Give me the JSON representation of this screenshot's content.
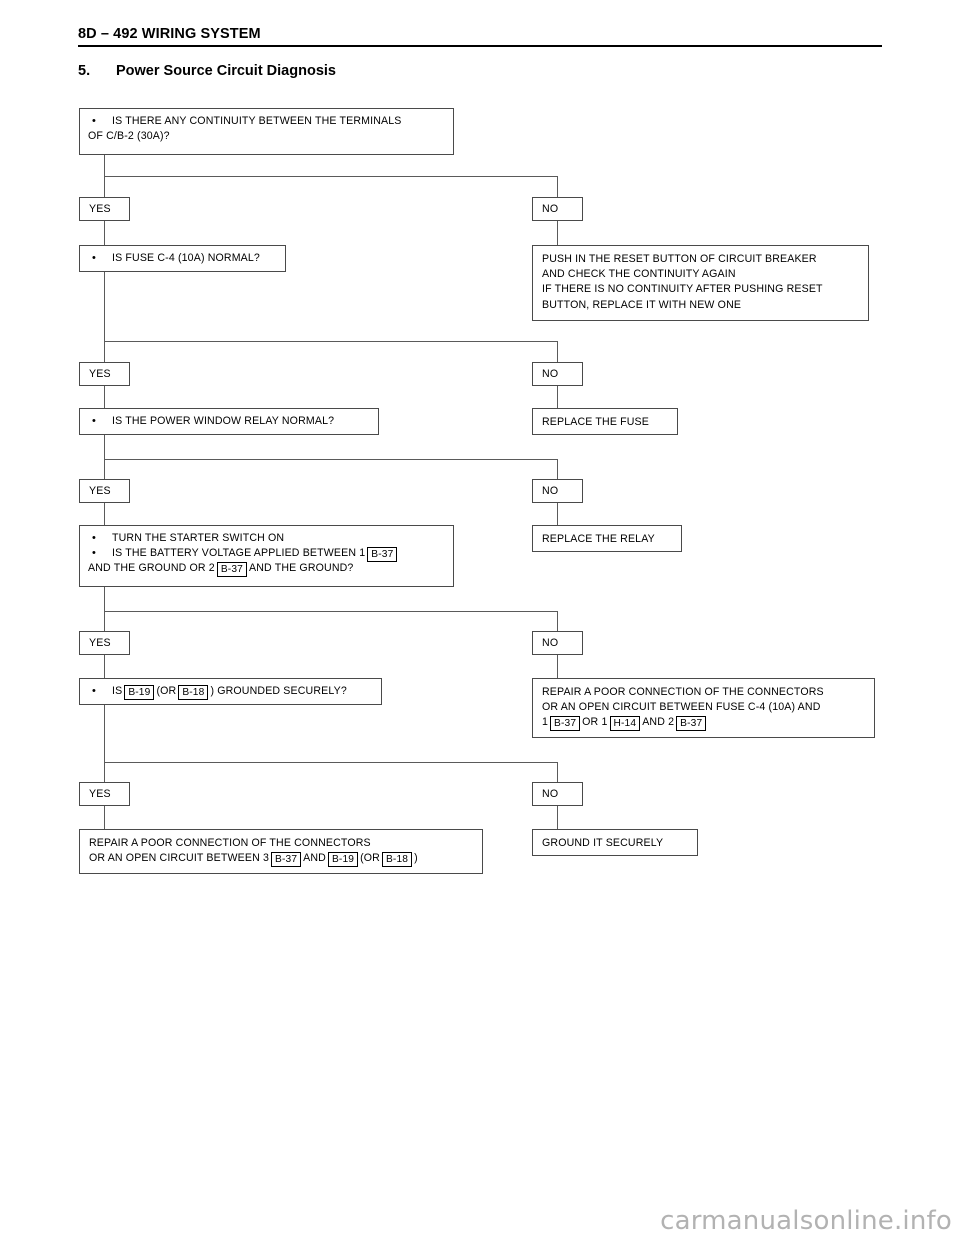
{
  "header": {
    "title": "8D – 492 WIRING SYSTEM"
  },
  "section": {
    "number": "5.",
    "title": "Power Source Circuit Diagnosis"
  },
  "labels": {
    "yes": "YES",
    "no": "NO",
    "bullet": "•"
  },
  "flow": {
    "q1": {
      "line1": "IS THERE ANY CONTINUITY BETWEEN THE TERMINALS",
      "line2": "OF C/B-2 (30A)?"
    },
    "a1_no": {
      "line1": "PUSH IN THE RESET BUTTON OF CIRCUIT BREAKER",
      "line2": "AND CHECK THE CONTINUITY AGAIN",
      "line3": "IF THERE IS NO CONTINUITY AFTER PUSHING RESET",
      "line4": "BUTTON, REPLACE IT WITH NEW ONE"
    },
    "q2": {
      "line1": "IS FUSE C-4 (10A) NORMAL?"
    },
    "a2_no": {
      "line1": "REPLACE THE FUSE"
    },
    "q3": {
      "line1": "IS THE POWER WINDOW RELAY NORMAL?"
    },
    "a3_no": {
      "line1": "REPLACE THE RELAY"
    },
    "q4": {
      "line1": "TURN THE STARTER SWITCH ON",
      "line2_a": "IS THE BATTERY VOLTAGE APPLIED BETWEEN 1",
      "line2_conn": "B-37",
      "line3_a": "AND THE GROUND OR 2",
      "line3_conn": "B-37",
      "line3_b": "AND THE GROUND?"
    },
    "a4_no": {
      "line1": "REPAIR A POOR CONNECTION OF THE CONNECTORS",
      "line2": "OR AN OPEN CIRCUIT BETWEEN FUSE C-4 (10A) AND",
      "line3_a": "1",
      "line3_conn1": "B-37",
      "line3_b": "OR 1",
      "line3_conn2": "H-14",
      "line3_c": "AND 2",
      "line3_conn3": "B-37"
    },
    "q5": {
      "line1_a": "IS",
      "line1_conn1": "B-19",
      "line1_b": "(OR",
      "line1_conn2": "B-18",
      "line1_c": ") GROUNDED SECURELY?"
    },
    "a5_no": {
      "line1": "GROUND IT SECURELY"
    },
    "a5_yes": {
      "line1": "REPAIR A POOR CONNECTION OF THE CONNECTORS",
      "line2_a": "OR AN OPEN CIRCUIT BETWEEN 3",
      "line2_conn1": "B-37",
      "line2_b": "AND",
      "line2_conn2": "B-19",
      "line2_c": "(OR",
      "line2_conn3": "B-18",
      "line2_d": ")"
    }
  },
  "watermark": {
    "text": "carmanualsonline.info"
  },
  "colors": {
    "page_background": "#ffffff",
    "text": "#000000",
    "box_border": "#4a4a4a",
    "line": "#5a5a5a",
    "watermark": "#b2b2b2"
  }
}
